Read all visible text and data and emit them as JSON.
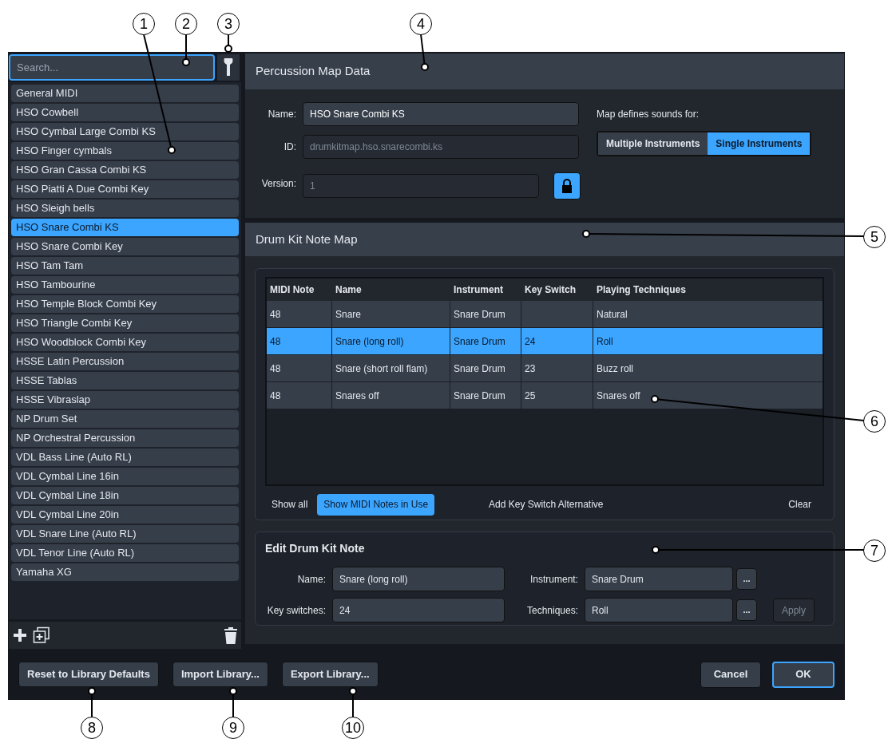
{
  "library": {
    "search": {
      "placeholder": "Search..."
    },
    "items": [
      {
        "label": "General MIDI",
        "selected": false
      },
      {
        "label": "HSO Cowbell",
        "selected": false
      },
      {
        "label": "HSO Cymbal Large Combi KS",
        "selected": false
      },
      {
        "label": "HSO Finger cymbals",
        "selected": false
      },
      {
        "label": "HSO Gran Cassa Combi KS",
        "selected": false
      },
      {
        "label": "HSO Piatti A Due Combi Key",
        "selected": false
      },
      {
        "label": "HSO Sleigh bells",
        "selected": false
      },
      {
        "label": "HSO Snare Combi KS",
        "selected": true
      },
      {
        "label": "HSO Snare Combi Key",
        "selected": false
      },
      {
        "label": "HSO Tam Tam",
        "selected": false
      },
      {
        "label": "HSO Tambourine",
        "selected": false
      },
      {
        "label": "HSO Temple Block Combi Key",
        "selected": false
      },
      {
        "label": "HSO Triangle Combi Key",
        "selected": false
      },
      {
        "label": "HSO Woodblock Combi Key",
        "selected": false
      },
      {
        "label": "HSSE Latin Percussion",
        "selected": false
      },
      {
        "label": "HSSE Tablas",
        "selected": false
      },
      {
        "label": "HSSE Vibraslap",
        "selected": false
      },
      {
        "label": "NP Drum Set",
        "selected": false
      },
      {
        "label": "NP Orchestral Percussion",
        "selected": false
      },
      {
        "label": "VDL Bass Line (Auto RL)",
        "selected": false
      },
      {
        "label": "VDL Cymbal Line 16in",
        "selected": false
      },
      {
        "label": "VDL Cymbal Line 18in",
        "selected": false
      },
      {
        "label": "VDL Cymbal Line 20in",
        "selected": false
      },
      {
        "label": "VDL Snare Line (Auto RL)",
        "selected": false
      },
      {
        "label": "VDL Tenor Line (Auto RL)",
        "selected": false
      },
      {
        "label": "Yamaha XG",
        "selected": false
      }
    ]
  },
  "map_data": {
    "title": "Percussion Map Data",
    "fields": [
      {
        "label": "Name:",
        "value": "HSO Snare Combi KS",
        "disabled": false
      },
      {
        "label": "ID:",
        "value": "drumkitmap.hso.snarecombi.ks",
        "disabled": true
      },
      {
        "label": "Version:",
        "value": "1",
        "disabled": true
      }
    ],
    "sounds_for": {
      "label": "Map defines sounds for:",
      "options": [
        {
          "label": "Multiple Instruments",
          "selected": false
        },
        {
          "label": "Single Instruments",
          "selected": true
        }
      ]
    }
  },
  "note_map": {
    "title": "Drum Kit Note Map",
    "columns": [
      "MIDI Note",
      "Name",
      "Instrument",
      "Key Switch",
      "Playing Techniques"
    ],
    "rows": [
      {
        "cells": [
          "48",
          "Snare",
          "Snare Drum",
          "",
          "Natural"
        ],
        "selected": false
      },
      {
        "cells": [
          "48",
          "Snare (long roll)",
          "Snare Drum",
          "24",
          "Roll"
        ],
        "selected": true
      },
      {
        "cells": [
          "48",
          "Snare (short roll flam)",
          "Snare Drum",
          "23",
          "Buzz roll"
        ],
        "selected": false
      },
      {
        "cells": [
          "48",
          "Snares off",
          "Snare Drum",
          "25",
          "Snares off"
        ],
        "selected": false
      }
    ],
    "filters": [
      {
        "label": "Show all",
        "selected": false
      },
      {
        "label": "Show MIDI Notes in Use",
        "selected": true
      }
    ],
    "actions": [
      "Add Key Switch Alternative",
      "Clear"
    ]
  },
  "edit_note": {
    "title": "Edit Drum Kit Note",
    "left_fields": [
      {
        "label": "Name:",
        "value": "Snare (long roll)"
      },
      {
        "label": "Key switches:",
        "value": "24"
      }
    ],
    "right_fields": [
      {
        "label": "Instrument:",
        "value": "Snare Drum",
        "button": "..."
      },
      {
        "label": "Techniques:",
        "value": "Roll",
        "button": "..."
      }
    ],
    "apply": {
      "label": "Apply",
      "disabled": true
    }
  },
  "footer": {
    "left_buttons": [
      "Reset to Library Defaults",
      "Import Library...",
      "Export Library..."
    ],
    "right_buttons": [
      {
        "label": "Cancel",
        "default": false
      },
      {
        "label": "OK",
        "default": true
      }
    ]
  },
  "callouts": [
    "1",
    "2",
    "3",
    "4",
    "5",
    "6",
    "7",
    "8",
    "9",
    "10"
  ]
}
